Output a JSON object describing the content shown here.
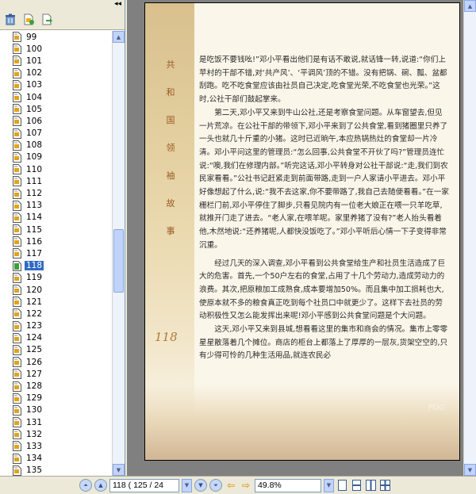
{
  "toolbar": {
    "collapse_symbol": "◂◂",
    "buttons": [
      {
        "icon": "delete-icon"
      },
      {
        "icon": "bookmark-add-icon"
      },
      {
        "icon": "export-page-icon"
      }
    ]
  },
  "page_list": {
    "items": [
      "99",
      "100",
      "101",
      "102",
      "103",
      "104",
      "105",
      "106",
      "107",
      "108",
      "109",
      "110",
      "111",
      "112",
      "113",
      "114",
      "115",
      "116",
      "117",
      "118",
      "119",
      "120",
      "121",
      "122",
      "123",
      "124",
      "125",
      "126",
      "127",
      "128",
      "129",
      "130",
      "131",
      "132",
      "133",
      "134",
      "135"
    ],
    "selected": "118",
    "scroll_position": 0.52
  },
  "document": {
    "side_title_chars": [
      "共",
      "和",
      "国",
      "领",
      "袖",
      "故",
      "事"
    ],
    "page_number": "118",
    "paragraphs": [
      {
        "cont": true,
        "text": "是吃饭不要钱吆!”邓小平看出他们是有话不敢说,就话锋一转,说道:“你们上苹村的干部不错,对‘共产风’、‘平调风’顶的不错。没有把锅、碗、瓢、盆都刮跑。吃不吃食堂应该由社员自己决定,吃食堂光荣,不吃食堂也光荣。”这时,公社干部们鼓起掌来。"
      },
      {
        "cont": false,
        "text": "第二天,邓小平又来到牛山公社,还是考察食堂问题。从车窗望去,但见一片荒凉。在公社干部的带领下,邓小平来到了公共食堂,看到猪圈里只养了一头也就几十斤重的小猪。这时已近晌午,本应热锅热灶的食堂却一片冷清。邓小平问这里的管理员:“怎么回事,公共食堂不开伙了吗?”管理员连忙说:“噢,我们在修理内部。”听完这话,邓小平转身对公社干部说:“走,我们到农民家看看。”公社书记赶紧走到前面带路,走到一户人家请小平进去。邓小平好像想起了什么,说:“我不去这家,你不要带路了,我自己去随便看看。”在一家栅栏门前,邓小平停住了脚步,只看见院内有一位老大娘正在喂一只羊吃草,就推开门走了进去。“老人家,在喂羊呢。家里养猪了没有?”老人抬头看着他,木然地说:“还养猪呢,人都快没饭吃了。”邓小平听后心情一下子变得非常沉重。"
      },
      {
        "cont": false,
        "gap": true,
        "text": "经过几天的深入调查,邓小平看到公共食堂给生产和社员生活造成了巨大的危害。首先,一个50户左右的食堂,占用了十几个劳动力,造成劳动力的浪费。其次,把原粮加工成熟食,成本要增加50%。而且集中加工损耗也大,使原本就不多的粮食真正吃到每个社员口中就更少了。这样下去社员的劳动积极性又怎么能发挥出来呢!邓小平感到公共食堂问题是个大问题。"
      },
      {
        "cont": false,
        "text": "这天,邓小平又来到县城,想看看这里的集市和商会的情况。集市上零零星星散落着几个摊位。商店的柜台上都落上了厚厚的一层灰,货架空空的,只有少得可怜的几种生活用品,就连农民必"
      }
    ],
    "watermark": "PDG"
  },
  "status_bar": {
    "current_page": "118",
    "page_field_text": "118  ( 125 / 24",
    "zoom": "49.8%"
  },
  "colors": {
    "selection": "#316ac5",
    "side_title": "#9a5a22",
    "page_number": "#b07a3a"
  }
}
